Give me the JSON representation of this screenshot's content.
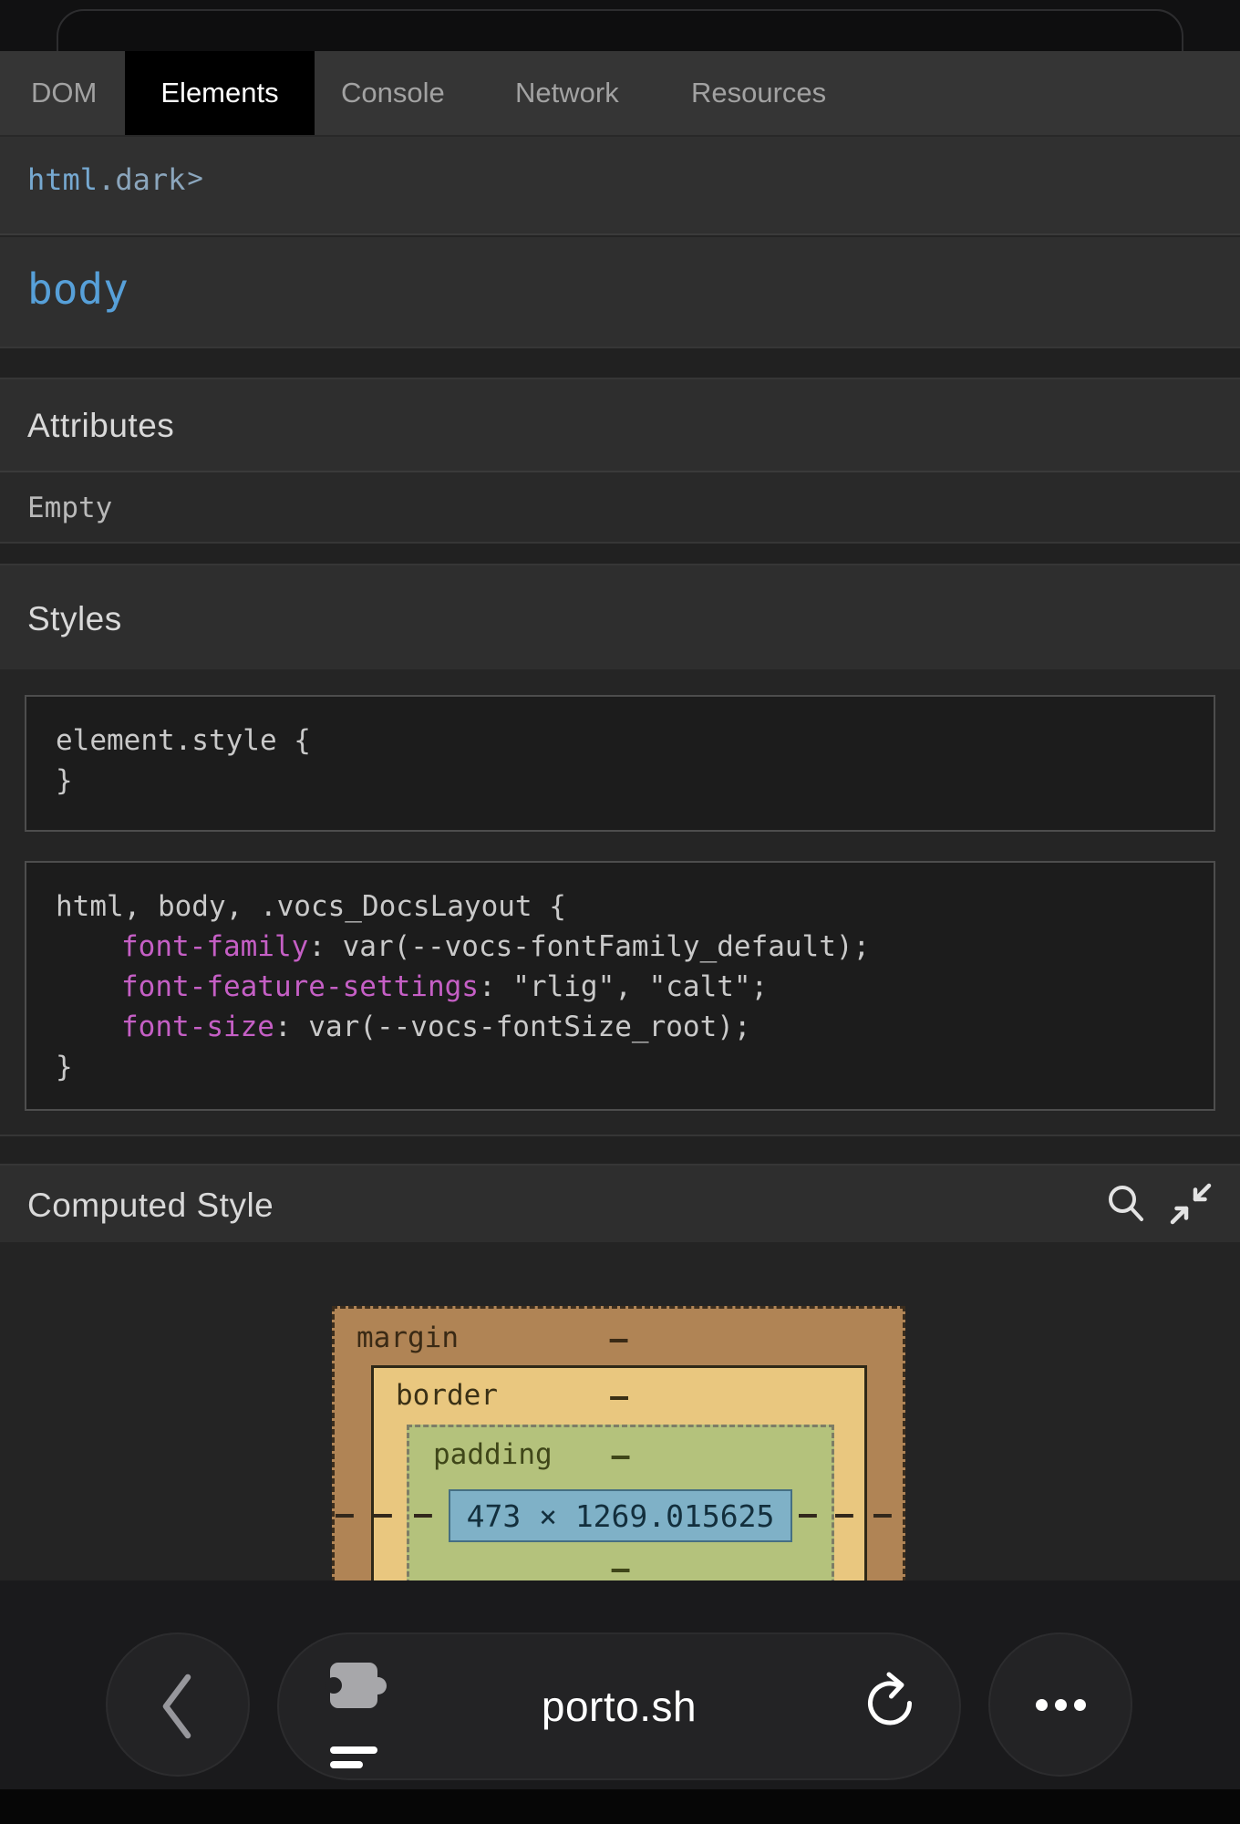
{
  "tabs": {
    "items": [
      {
        "label": "DOM"
      },
      {
        "label": "Elements"
      },
      {
        "label": "Console"
      },
      {
        "label": "Network"
      },
      {
        "label": "Resources"
      }
    ],
    "active_tab": "Elements"
  },
  "breadcrumb": {
    "tag": "html",
    "class_suffix": ".dark",
    "chevron": ">"
  },
  "node": {
    "name": "body"
  },
  "attributes": {
    "title": "Attributes",
    "empty_label": "Empty"
  },
  "styles": {
    "title": "Styles",
    "inline_rule": {
      "open": "element.style {",
      "close": "}"
    },
    "matched_rule": {
      "selector": "html, body, .vocs_DocsLayout {",
      "props": [
        {
          "name": "font-family",
          "rest": ": var(--vocs-fontFamily_default);"
        },
        {
          "name": "font-feature-settings",
          "rest": ": \"rlig\", \"calt\";"
        },
        {
          "name": "font-size",
          "rest": ": var(--vocs-fontSize_root);"
        }
      ],
      "close": "}"
    }
  },
  "computed": {
    "title": "Computed Style"
  },
  "box_model": {
    "margin_label": "margin",
    "border_label": "border",
    "padding_label": "padding",
    "dash": "–",
    "content_size": "473 × 1269.015625"
  },
  "browser": {
    "url": "porto.sh"
  },
  "colors": {
    "node_blue": "#57a0d9",
    "selector_blue": "#76a9d1",
    "property_magenta": "#c55fc5",
    "box_margin": "#b08455",
    "box_border": "#e9c77f",
    "box_padding": "#b4c27c",
    "box_content": "#7fb1c7",
    "tab_active_bg": "#000000"
  }
}
